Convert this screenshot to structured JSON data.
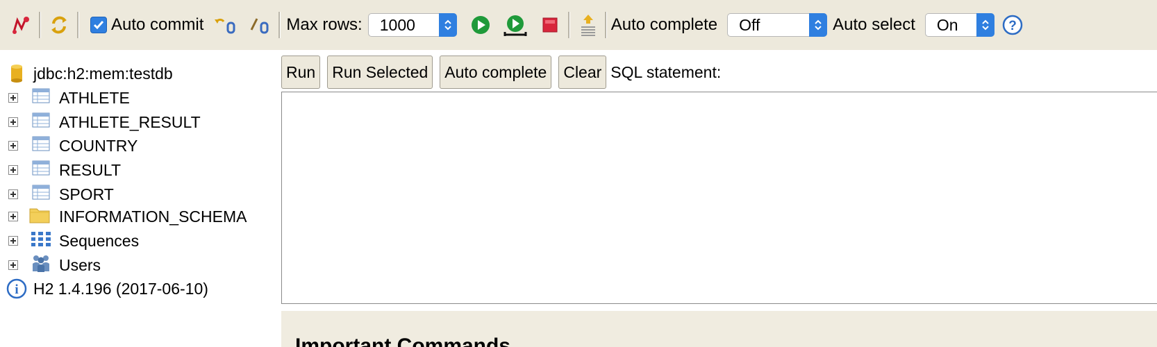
{
  "toolbar": {
    "auto_commit_label": "Auto commit",
    "auto_commit_checked": true,
    "max_rows_label": "Max rows:",
    "max_rows_value": "1000",
    "auto_complete_label": "Auto complete",
    "auto_complete_value": "Off",
    "auto_select_label": "Auto select",
    "auto_select_value": "On",
    "icons": [
      "disconnect-icon",
      "refresh-icon",
      "rollback-icon",
      "commit-icon",
      "run-icon",
      "run-selected-icon",
      "stop-icon",
      "history-icon",
      "help-icon"
    ],
    "accent_color": "#2f7fe0"
  },
  "tree": {
    "connection": "jdbc:h2:mem:testdb",
    "items": [
      {
        "label": "ATHLETE",
        "icon": "table-icon"
      },
      {
        "label": "ATHLETE_RESULT",
        "icon": "table-icon"
      },
      {
        "label": "COUNTRY",
        "icon": "table-icon"
      },
      {
        "label": "RESULT",
        "icon": "table-icon"
      },
      {
        "label": "SPORT",
        "icon": "table-icon"
      },
      {
        "label": "INFORMATION_SCHEMA",
        "icon": "folder-icon"
      },
      {
        "label": "Sequences",
        "icon": "sequences-icon"
      },
      {
        "label": "Users",
        "icon": "users-icon"
      }
    ],
    "version": "H2 1.4.196 (2017-06-10)"
  },
  "main": {
    "buttons": {
      "run": "Run",
      "run_selected": "Run Selected",
      "auto_complete": "Auto complete",
      "clear": "Clear"
    },
    "sql_label": "SQL statement:",
    "sql_value": "",
    "important_commands_title": "Important Commands"
  }
}
